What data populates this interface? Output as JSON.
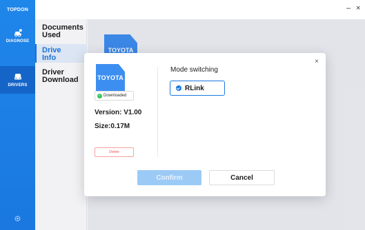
{
  "brand": "TOPDON",
  "rail": {
    "items": [
      {
        "label": "DIAGNOSE",
        "icon": "car-diagnose-icon"
      },
      {
        "label": "DRIVERS",
        "icon": "car-drivers-icon"
      }
    ],
    "settings_icon": "gear-icon"
  },
  "window": {
    "minimize": "–",
    "close": "×"
  },
  "subnav": {
    "items": [
      {
        "label": "Documents Used"
      },
      {
        "label": "Drive Info"
      },
      {
        "label": "Driver Download"
      }
    ]
  },
  "content": {
    "card_label": "TOYOTA"
  },
  "dialog": {
    "close": "×",
    "brand_label": "TOYOTA",
    "badge": "Downloaded",
    "version": "Version: V1.00",
    "size": "Size:0.17M",
    "delete": "Delete",
    "mode_title": "Mode switching",
    "mode_option": "RLink",
    "confirm": "Confirm",
    "cancel": "Cancel"
  },
  "colors": {
    "primary": "#1a78e0",
    "accent_doc": "#3d8ef1",
    "success": "#36c45a",
    "danger": "#e45555"
  }
}
